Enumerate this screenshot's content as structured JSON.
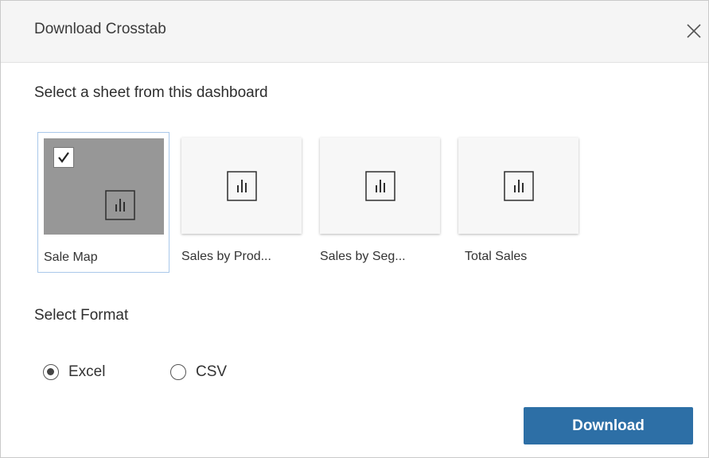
{
  "dialog": {
    "title": "Download Crosstab"
  },
  "sheet_section": {
    "label": "Select a sheet from this dashboard",
    "sheets": [
      {
        "label": "Sale Map",
        "selected": true
      },
      {
        "label": "Sales by Prod...",
        "selected": false
      },
      {
        "label": "Sales by Seg...",
        "selected": false
      },
      {
        "label": "Total Sales",
        "selected": false
      }
    ]
  },
  "format_section": {
    "label": "Select Format",
    "options": [
      {
        "label": "Excel",
        "selected": true
      },
      {
        "label": "CSV",
        "selected": false
      }
    ]
  },
  "actions": {
    "download_label": "Download"
  },
  "colors": {
    "primary": "#2d6fa6",
    "selected_thumb": "#979797",
    "selected_border": "#a9c8ea"
  },
  "icons": {
    "close": "close-icon",
    "sheet": "bar-chart-icon",
    "check": "checkmark-icon"
  }
}
